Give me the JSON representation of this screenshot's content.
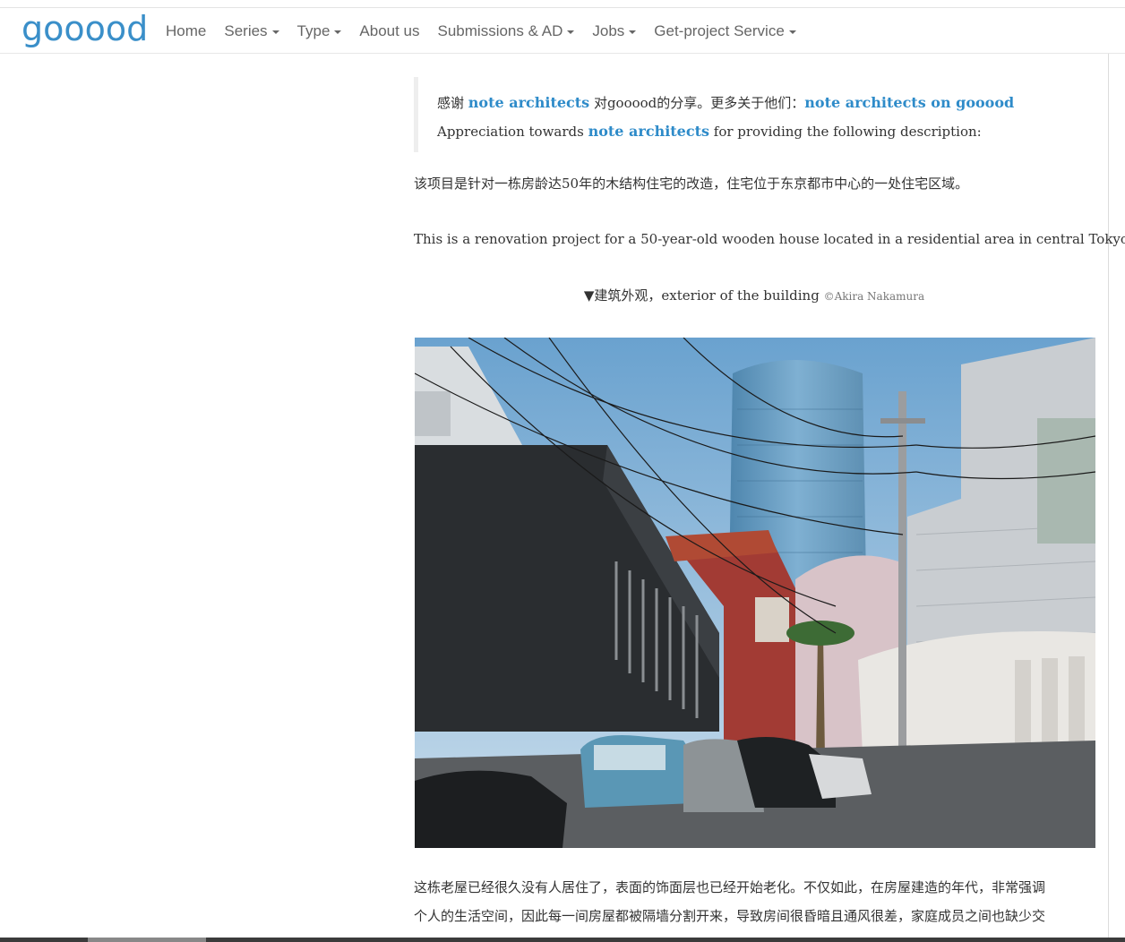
{
  "brand": {
    "logo_text": "gooood",
    "color": "#3a8fc9"
  },
  "nav": [
    {
      "label": "Home",
      "dropdown": false
    },
    {
      "label": "Series",
      "dropdown": true
    },
    {
      "label": "Type",
      "dropdown": true
    },
    {
      "label": "About us",
      "dropdown": false
    },
    {
      "label": "Submissions & AD",
      "dropdown": true
    },
    {
      "label": "Jobs",
      "dropdown": true
    },
    {
      "label": "Get-project Service",
      "dropdown": true
    }
  ],
  "quote": {
    "line1_prefix": "感谢 ",
    "line1_link1": "note architects",
    "line1_mid": " 对gooood的分享。更多关于他们：",
    "line1_link2": "note architects on gooood",
    "line2_prefix": "Appreciation towards ",
    "line2_link": "note architects",
    "line2_suffix": " for providing the following description:"
  },
  "article": {
    "p1_cn": "该项目是针对一栋房龄达50年的木结构住宅的改造，住宅位于东京都市中心的一处住宅区域。",
    "p1_en": "This is a renovation project for a 50-year-old wooden house located in a residential area in central Tokyo.",
    "caption_text": "▼建筑外观，exterior of the building ",
    "caption_credit": "©Akira Nakamura",
    "p2_line1": "这栋老屋已经很久没有人居住了，表面的饰面层也已经开始老化。不仅如此，在房屋建造的年代，非常强调",
    "p2_line2": "个人的生活空间，因此每一间房屋都被隔墙分割开来，导致房间很昏暗且通风很差，家庭成员之间也缺少交"
  },
  "colors": {
    "link": "#2e8bc9",
    "nav_text": "#666666",
    "body_text": "#333333"
  }
}
